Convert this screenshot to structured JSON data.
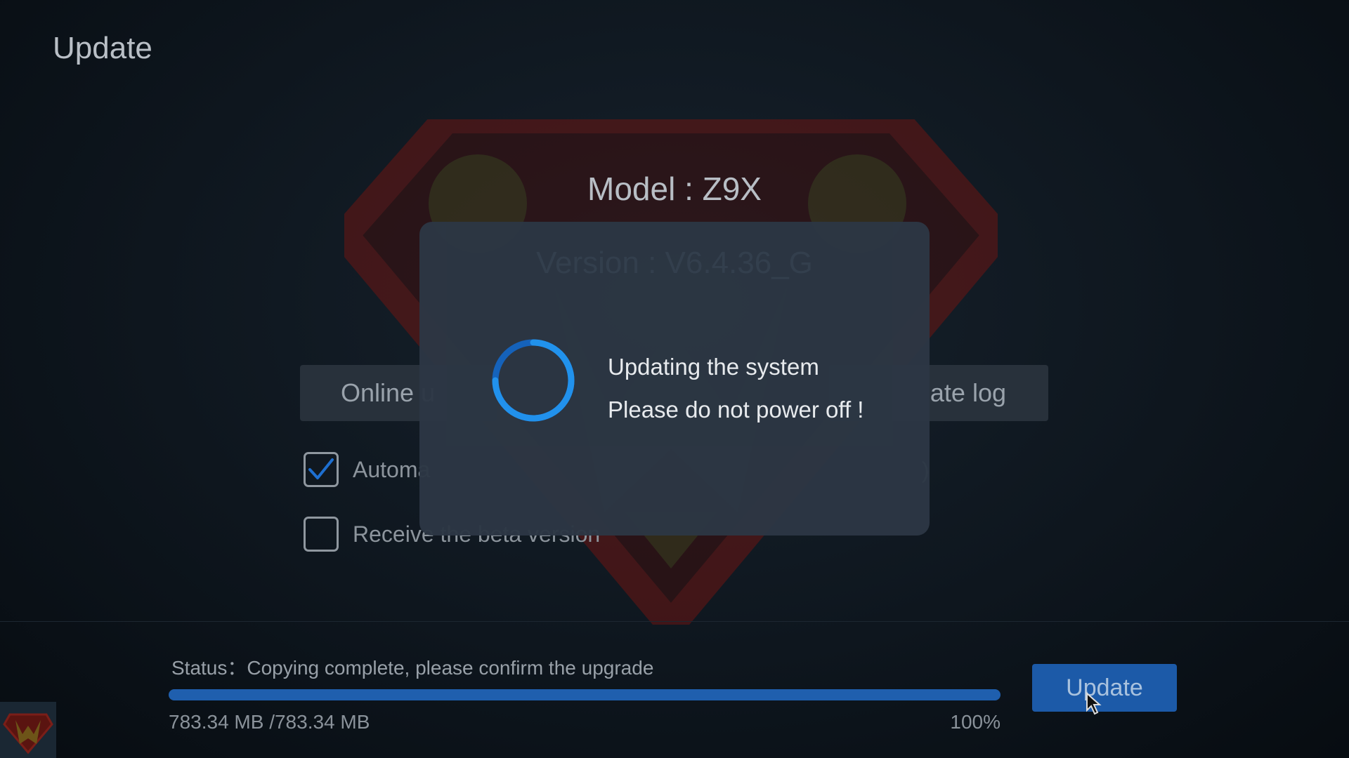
{
  "header": {
    "title": "Update"
  },
  "device": {
    "model_text": "Model : Z9X",
    "version_text": "Version : V6.4.36_G"
  },
  "tabs": {
    "online_label": "Online u",
    "log_label": "ate log"
  },
  "options": {
    "auto_check": {
      "label": "Automa",
      "tail": ")",
      "checked": true
    },
    "beta": {
      "label": "Receive the beta version",
      "checked": false
    }
  },
  "status": {
    "label": "Status：",
    "message": "Copying complete, please confirm the upgrade",
    "progress_percent": 100,
    "size_text": "783.34 MB /783.34 MB",
    "percent_text": "100%"
  },
  "actions": {
    "update_label": "Update"
  },
  "dialog": {
    "line1": "Updating the system",
    "line2": "Please do not power off !"
  },
  "colors": {
    "accent": "#1c5aa8",
    "spinner": "#1e88e5",
    "modal_bg": "#2c3744",
    "emblem_red": "#6b1512",
    "emblem_gold": "#6d5418"
  },
  "icons": {
    "spinner": "loading-spinner-icon",
    "checkmark": "checkmark-icon",
    "cursor": "mouse-cursor-icon",
    "logo": "superman-logo-icon"
  }
}
